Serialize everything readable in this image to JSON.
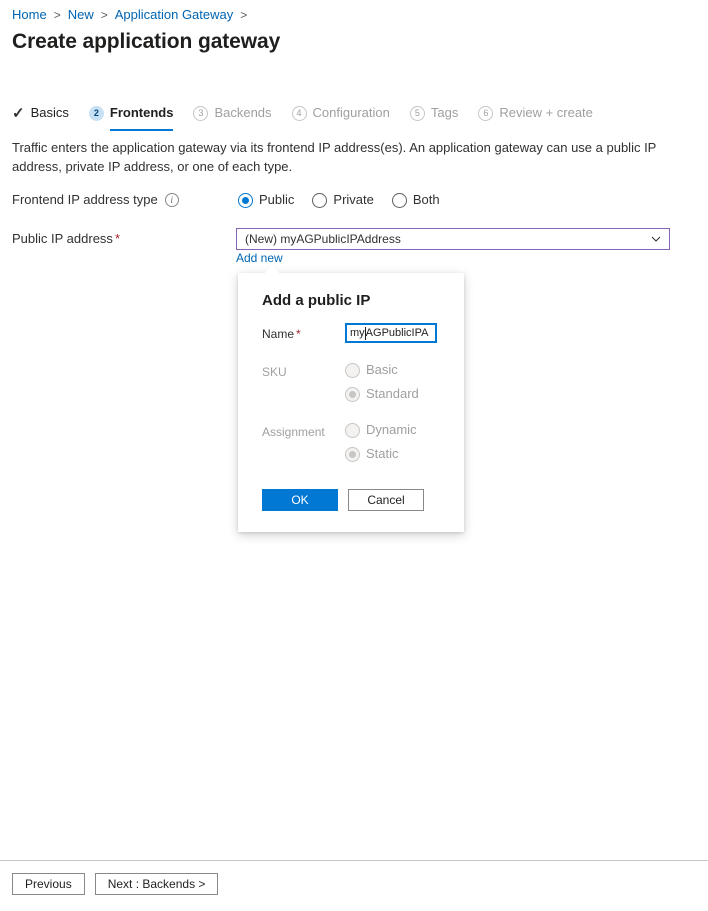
{
  "breadcrumb": {
    "items": [
      {
        "label": "Home"
      },
      {
        "label": "New"
      },
      {
        "label": "Application Gateway"
      }
    ],
    "separator": ">"
  },
  "page": {
    "title": "Create application gateway"
  },
  "tabs": [
    {
      "label": "Basics",
      "badge": "✓",
      "state": "done"
    },
    {
      "label": "Frontends",
      "badge": "2",
      "state": "active"
    },
    {
      "label": "Backends",
      "badge": "3",
      "state": "future"
    },
    {
      "label": "Configuration",
      "badge": "4",
      "state": "future"
    },
    {
      "label": "Tags",
      "badge": "5",
      "state": "future"
    },
    {
      "label": "Review + create",
      "badge": "6",
      "state": "future"
    }
  ],
  "main": {
    "description": "Traffic enters the application gateway via its frontend IP address(es). An application gateway can use a public IP address, private IP address, or one of each type.",
    "frontend_ip_type": {
      "label": "Frontend IP address type",
      "info_icon": "info-icon",
      "options": [
        {
          "label": "Public",
          "selected": true
        },
        {
          "label": "Private",
          "selected": false
        },
        {
          "label": "Both",
          "selected": false
        }
      ]
    },
    "public_ip": {
      "label": "Public IP address",
      "required_marker": "*",
      "selected_value": "(New) myAGPublicIPAddress",
      "chevron_icon": "chevron-down-icon",
      "add_new_label": "Add new"
    }
  },
  "callout": {
    "title": "Add a public IP",
    "name": {
      "label": "Name",
      "required_marker": "*",
      "value_before_caret": "my",
      "value_after_caret": "AGPublicIPA"
    },
    "sku": {
      "label": "SKU",
      "disabled": true,
      "options": [
        {
          "label": "Basic",
          "selected": false
        },
        {
          "label": "Standard",
          "selected": true
        }
      ]
    },
    "assignment": {
      "label": "Assignment",
      "disabled": true,
      "options": [
        {
          "label": "Dynamic",
          "selected": false
        },
        {
          "label": "Static",
          "selected": true
        }
      ]
    },
    "ok_label": "OK",
    "cancel_label": "Cancel"
  },
  "footer": {
    "previous_label": "Previous",
    "next_label": "Next : Backends >"
  },
  "colors": {
    "accent": "#0078d4",
    "link": "#0065b3",
    "required": "#a4262c",
    "dropdown_border": "#8764b8",
    "disabled_text": "#a19f9d"
  }
}
